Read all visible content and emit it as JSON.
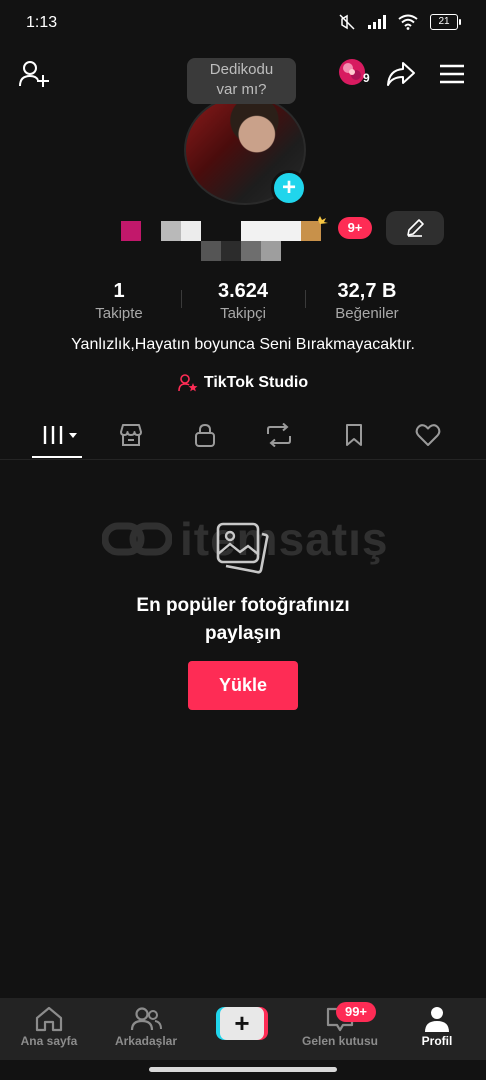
{
  "status_bar": {
    "time": "1:13",
    "battery": "21"
  },
  "header": {
    "add_friend_icon": "person-plus-icon",
    "bubble_text_1": "Dedikodu",
    "bubble_text_2": "var mı?",
    "gem_count": "9",
    "share_icon": "share-arrow-icon",
    "menu_icon": "hamburger-icon"
  },
  "profile": {
    "notifications_badge": "9+",
    "stats": [
      {
        "value": "1",
        "label": "Takipte"
      },
      {
        "value": "3.624",
        "label": "Takipçi"
      },
      {
        "value": "32,7 B",
        "label": "Beğeniler"
      }
    ],
    "bio": "Yanlızlık,Hayatın boyunca Seni Bırakmayacaktır.",
    "studio_label": "TikTok Studio"
  },
  "tabs": [
    "videos-grid",
    "shop",
    "private",
    "reposts",
    "favorites",
    "liked"
  ],
  "empty_state": {
    "watermark": "itemsatış",
    "title_line1": "En popüler fotoğrafınızı",
    "title_line2": "paylaşın",
    "button": "Yükle"
  },
  "bottom_nav": {
    "home": "Ana sayfa",
    "friends": "Arkadaşlar",
    "create": "+",
    "inbox": "Gelen kutusu",
    "inbox_badge": "99+",
    "profile": "Profil"
  },
  "colors": {
    "accent": "#fe2c55",
    "cyan": "#20d5ec",
    "background": "#121212"
  }
}
